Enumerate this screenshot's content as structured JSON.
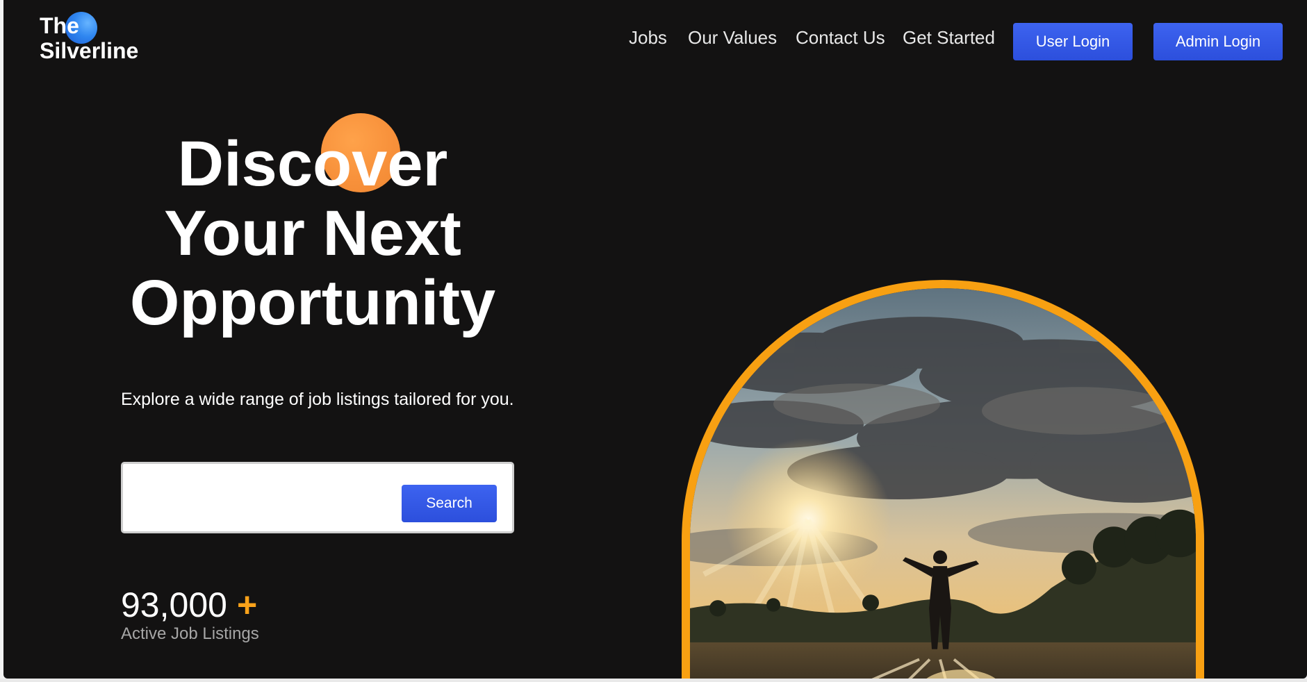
{
  "brand": {
    "line1": "The",
    "line2": "Silverline"
  },
  "nav": {
    "links": [
      "Jobs",
      "Our Values",
      "Contact Us",
      "Get Started"
    ],
    "user_login": "User Login",
    "admin_login": "Admin Login"
  },
  "hero": {
    "title_line1": "Discover",
    "title_line2": "Your Next",
    "title_line3": "Opportunity",
    "subtitle": "Explore a wide range of job listings tailored for you.",
    "search_value": "",
    "search_button": "Search"
  },
  "stats": {
    "count": "93,000",
    "plus": "+",
    "label": "Active Job Listings"
  },
  "colors": {
    "background": "#131212",
    "primary_button": "#3558e8",
    "accent_orange": "#f8a012",
    "orb_orange": "#f7903a",
    "logo_blue": "#2f86f0"
  },
  "icons": {
    "logo_mark": "blue-circle",
    "hero_accent": "orange-circle"
  }
}
